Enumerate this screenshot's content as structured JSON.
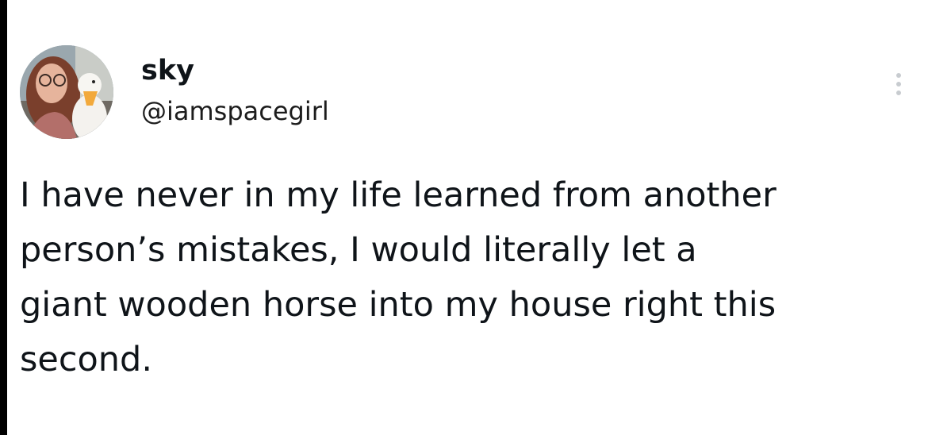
{
  "author": {
    "display_name": "sky",
    "handle": "@iamspacegirl",
    "avatar_icon": "profile-photo-with-duck"
  },
  "more_icon": "ellipsis-vertical-icon",
  "tweet": {
    "lines": [
      "I have never in my life learned from another",
      "person’s mistakes, I would literally let a",
      "giant wooden horse into my house right this",
      "second."
    ]
  },
  "colors": {
    "background": "#ffffff",
    "text": "#0f1419",
    "menu_dots": "#c8ccd0"
  }
}
